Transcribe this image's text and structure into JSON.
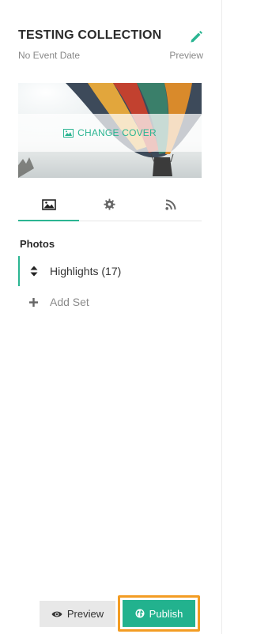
{
  "collection": {
    "title": "TESTING COLLECTION",
    "event_date": "No Event Date",
    "preview_link": "Preview"
  },
  "cover": {
    "change_label": "CHANGE COVER"
  },
  "tabs": [
    {
      "name": "photos",
      "icon": "image-icon",
      "active": true
    },
    {
      "name": "settings",
      "icon": "gear-icon",
      "active": false
    },
    {
      "name": "feed",
      "icon": "rss-icon",
      "active": false
    }
  ],
  "photos": {
    "section_title": "Photos",
    "sets": [
      {
        "label": "Highlights (17)",
        "icon": "sort-icon"
      }
    ],
    "add_set_label": "Add Set"
  },
  "actions": {
    "preview_label": "Preview",
    "publish_label": "Publish"
  },
  "colors": {
    "accent": "#2bb592",
    "publish_bg": "#22b28e",
    "highlight_outline": "#f39c23",
    "preview_bg": "#e8e8e8"
  }
}
